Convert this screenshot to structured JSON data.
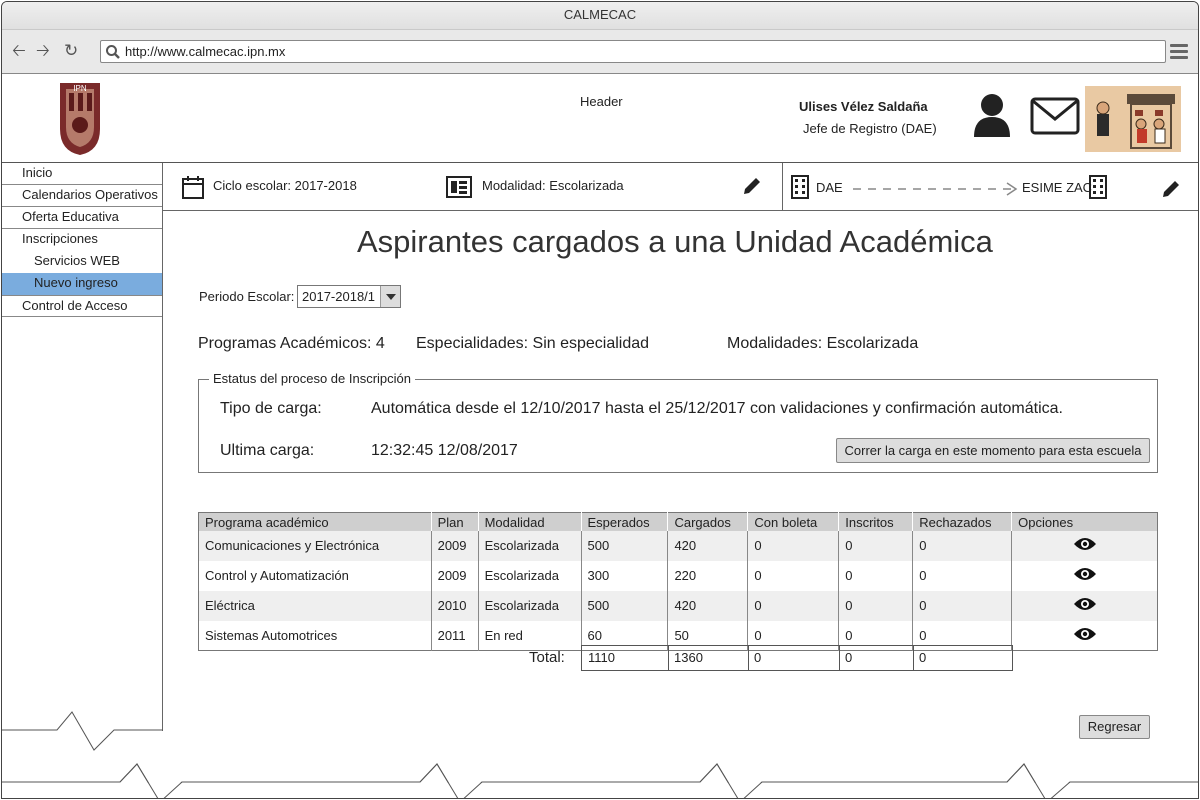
{
  "window": {
    "title": "CALMECAC",
    "url": "http://www.calmecac.ipn.mx"
  },
  "header": {
    "label": "Header",
    "logo_text": "IPN",
    "user_name": "Ulises Vélez Saldaña",
    "user_role": "Jefe de Registro (DAE)"
  },
  "sidebar": {
    "items": [
      {
        "label": "Inicio"
      },
      {
        "label": "Calendarios Operativos"
      },
      {
        "label": "Oferta Educativa"
      },
      {
        "label": "Inscripciones"
      },
      {
        "label": "Servicios WEB"
      },
      {
        "label": "Nuevo ingreso"
      },
      {
        "label": "Control de Acceso"
      }
    ]
  },
  "infobar": {
    "ciclo": "Ciclo escolar: 2017-2018",
    "modalidad": "Modalidad: Escolarizada",
    "from": "DAE",
    "to": "ESIME ZAC"
  },
  "page": {
    "title": "Aspirantes cargados a una Unidad Académica",
    "periodo_label": "Periodo Escolar:",
    "periodo_value": "2017-2018/1",
    "programas": "Programas Académicos:  4",
    "especialidades": "Especialidades: Sin especialidad",
    "modalidades": "Modalidades: Escolarizada"
  },
  "status": {
    "legend": "Estatus del proceso de Inscripción",
    "tipo_label": "Tipo de carga:",
    "tipo_value": "Automática desde el 12/10/2017 hasta el 25/12/2017 con validaciones y confirmación automática.",
    "ultima_label": "Ultima carga:",
    "ultima_value": "12:32:45 12/08/2017",
    "run_button": "Correr la carga en este momento para esta escuela"
  },
  "table": {
    "headers": [
      "Programa académico",
      "Plan",
      "Modalidad",
      "Esperados",
      "Cargados",
      "Con boleta",
      "Inscritos",
      "Rechazados",
      "Opciones"
    ],
    "rows": [
      [
        "Comunicaciones y Electrónica",
        "2009",
        "Escolarizada",
        "500",
        "420",
        "0",
        "0",
        "0"
      ],
      [
        "Control y Automatización",
        "2009",
        "Escolarizada",
        "300",
        "220",
        "0",
        "0",
        "0"
      ],
      [
        "Eléctrica",
        "2010",
        "Escolarizada",
        "500",
        "420",
        "0",
        "0",
        "0"
      ],
      [
        "Sistemas Automotrices",
        "2011",
        "En red",
        "60",
        "50",
        "0",
        "0",
        "0"
      ]
    ],
    "total_label": "Total:",
    "totals": [
      "1110",
      "1360",
      "0",
      "0",
      "0"
    ]
  },
  "actions": {
    "back": "Regresar"
  }
}
